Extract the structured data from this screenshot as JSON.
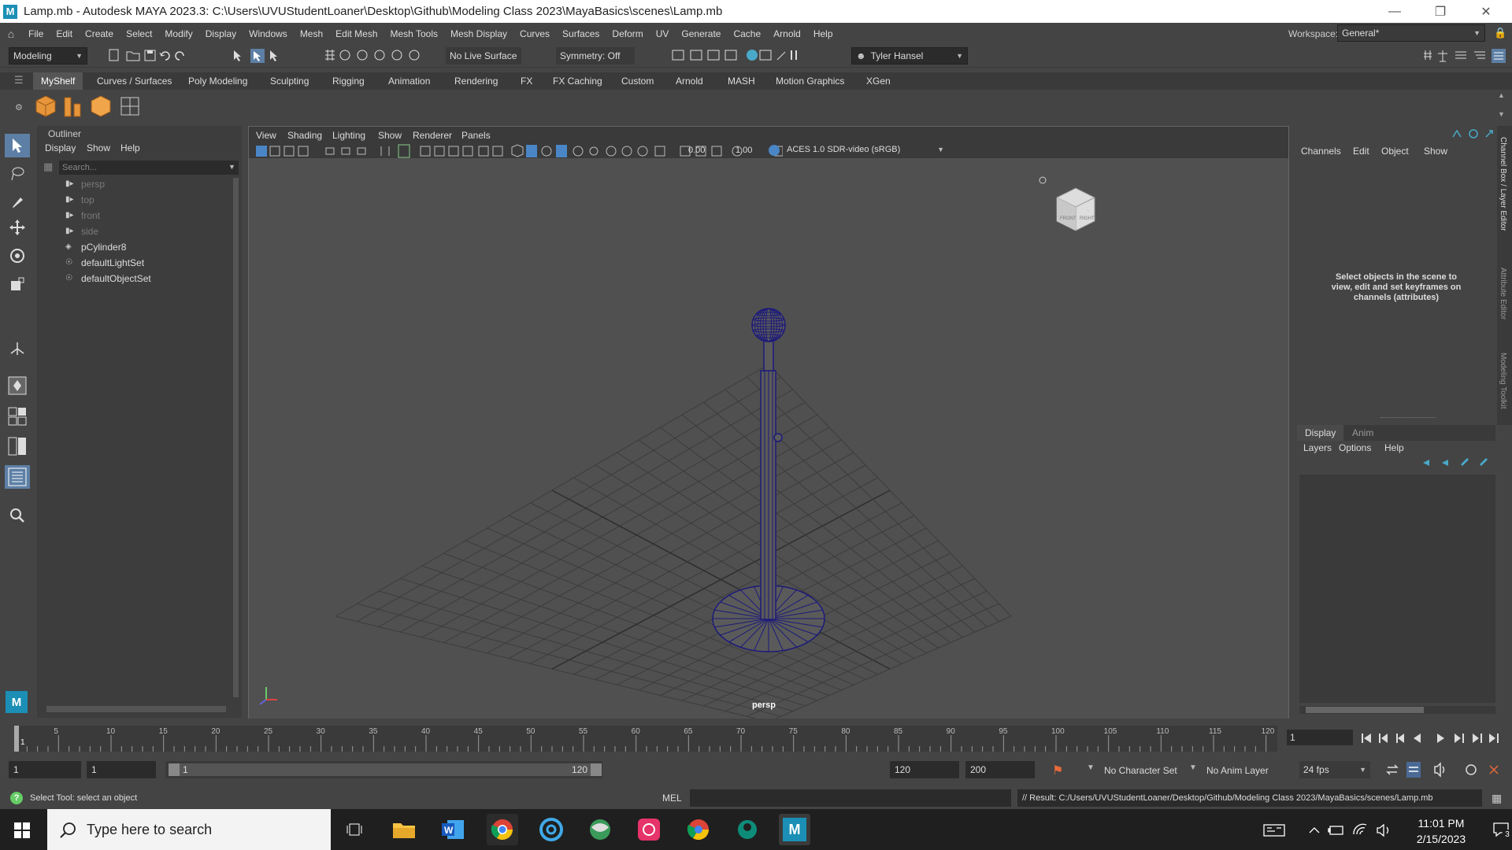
{
  "window": {
    "title": "Lamp.mb - Autodesk MAYA 2023.3: C:\\Users\\UVUStudentLoaner\\Desktop\\Github\\Modeling Class 2023\\MayaBasics\\scenes\\Lamp.mb",
    "app_icon_letter": "M"
  },
  "menubar": {
    "items": [
      "File",
      "Edit",
      "Create",
      "Select",
      "Modify",
      "Display",
      "Windows",
      "Mesh",
      "Edit Mesh",
      "Mesh Tools",
      "Mesh Display",
      "Curves",
      "Surfaces",
      "Deform",
      "UV",
      "Generate",
      "Cache",
      "Arnold",
      "Help"
    ],
    "workspace_label": "Workspace:",
    "workspace_value": "General*"
  },
  "statusline": {
    "menuset": "Modeling",
    "live_surface": "No Live Surface",
    "symmetry": "Symmetry: Off",
    "user": "Tyler Hansel"
  },
  "shelf": {
    "tabs": [
      "MyShelf",
      "Curves / Surfaces",
      "Poly Modeling",
      "Sculpting",
      "Rigging",
      "Animation",
      "Rendering",
      "FX",
      "FX Caching",
      "Custom",
      "Arnold",
      "MASH",
      "Motion Graphics",
      "XGen"
    ],
    "active_tab": "MyShelf"
  },
  "outliner": {
    "title": "Outliner",
    "menus": [
      "Display",
      "Show",
      "Help"
    ],
    "search_placeholder": "Search...",
    "items": [
      {
        "label": "persp",
        "kind": "camera"
      },
      {
        "label": "top",
        "kind": "camera"
      },
      {
        "label": "front",
        "kind": "camera"
      },
      {
        "label": "side",
        "kind": "camera"
      },
      {
        "label": "pCylinder8",
        "kind": "mesh"
      },
      {
        "label": "defaultLightSet",
        "kind": "set"
      },
      {
        "label": "defaultObjectSet",
        "kind": "set"
      }
    ]
  },
  "viewport": {
    "menus": [
      "View",
      "Shading",
      "Lighting",
      "Show",
      "Renderer",
      "Panels"
    ],
    "exposure": "0.00",
    "gamma": "1.00",
    "color_space": "ACES 1.0 SDR-video (sRGB)",
    "camera_label": "persp",
    "viewcube_front": "FRONT",
    "viewcube_right": "RIGHT"
  },
  "channelbox": {
    "menus": [
      "Channels",
      "Edit",
      "Object",
      "Show"
    ],
    "message": "Select objects in the scene to view, edit and set keyframes on channels (attributes)",
    "side_tabs": [
      "Channel Box / Layer Editor",
      "Attribute Editor",
      "Modeling Toolkit"
    ],
    "layer_tabs": [
      "Display",
      "Anim"
    ],
    "layer_menus": [
      "Layers",
      "Options",
      "Help"
    ]
  },
  "timeline": {
    "ticks": [
      "5",
      "10",
      "15",
      "20",
      "25",
      "30",
      "35",
      "40",
      "45",
      "50",
      "55",
      "60",
      "65",
      "70",
      "75",
      "80",
      "85",
      "90",
      "95",
      "100",
      "105",
      "110",
      "115",
      "120"
    ],
    "first_tick": "1",
    "current_frame": "1"
  },
  "range": {
    "start": "1",
    "playback_start": "1",
    "slider_start": "1",
    "slider_end": "120",
    "playback_end": "120",
    "end": "200",
    "character_set": "No Character Set",
    "anim_layer": "No Anim Layer",
    "fps": "24 fps"
  },
  "command": {
    "help_text": "Select Tool: select an object",
    "language": "MEL",
    "result": "// Result: C:/Users/UVUStudentLoaner/Desktop/Github/Modeling Class 2023/MayaBasics/scenes/Lamp.mb"
  },
  "taskbar": {
    "search_placeholder": "Type here to search",
    "time": "11:01 PM",
    "date": "2/15/2023",
    "notification_count": "3"
  }
}
